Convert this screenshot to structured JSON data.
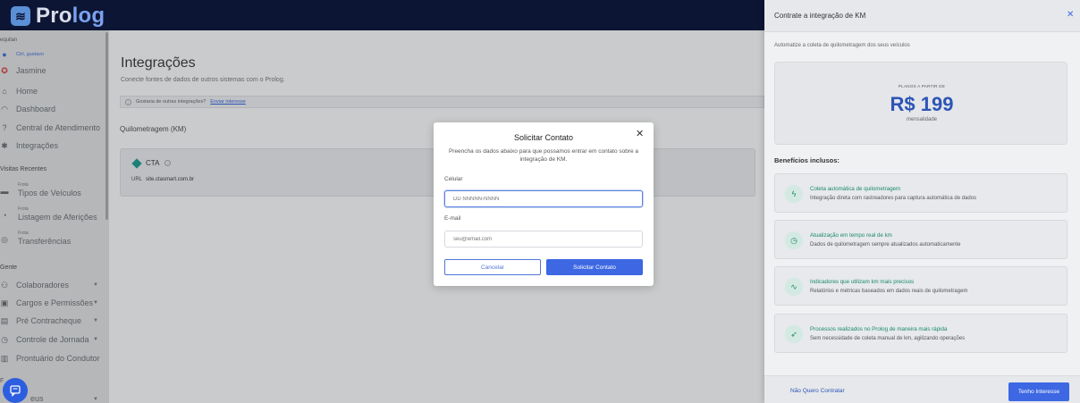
{
  "app": {
    "logo_prefix": "Pro",
    "logo_accent": "log"
  },
  "sidebar": {
    "context_label": "equilan",
    "user_label": "Ctrl, gustavo",
    "items_top": [
      {
        "label": "Jasmine",
        "icon": "company-badge-icon"
      },
      {
        "label": "Home",
        "icon": "home-icon"
      },
      {
        "label": "Dashboard",
        "icon": "gauge-icon"
      },
      {
        "label": "Central de Atendimento",
        "icon": "help-circle-icon"
      },
      {
        "label": "Integrações",
        "icon": "puzzle-icon"
      }
    ],
    "recent_section": "Visitas Recentes",
    "recent": [
      {
        "mini": "Frota",
        "label": "Tipos de Veículos"
      },
      {
        "mini": "Frota",
        "label": "Listagem de Aferições"
      },
      {
        "mini": "Frota",
        "label": "Transferências"
      }
    ],
    "people_section": "Gente",
    "people": [
      {
        "label": "Colaboradores",
        "icon": "users-icon"
      },
      {
        "label": "Cargos e Permissões",
        "icon": "id-card-icon"
      },
      {
        "label": "Pré Contracheque",
        "icon": "wallet-icon"
      },
      {
        "label": "Controle de Jornada",
        "icon": "clock-search-icon"
      },
      {
        "label": "Prontuário do Condutor",
        "icon": "folder-icon"
      }
    ],
    "bottom_mini": "F",
    "bottom_label": "eus"
  },
  "main": {
    "title": "Integrações",
    "subtitle": "Conecte fontes de dados de outros sistemas com o Prolog.",
    "info_text": "Gostaria de outras integrações?",
    "info_link": "Enviar interesse",
    "section": "Quilometragem (KM)",
    "card": {
      "name": "CTA",
      "url_label": "URL",
      "url": "site.ctasmart.com.br"
    }
  },
  "modal": {
    "title": "Solicitar Contato",
    "description": "Preencha os dados abaixo para que possamos entrar em contato sobre a integração de KM.",
    "phone_label": "Celular",
    "phone_placeholder": "DD NNNNN-NNNN",
    "email_label": "E-mail",
    "email_placeholder": "seu@email.com",
    "cancel": "Cancelar",
    "submit": "Solicitar Contato"
  },
  "drawer": {
    "title": "Contrate a integração de KM",
    "subtitle": "Automatize a coleta de quilometragem dos seus veículos",
    "price_prefix": "PLANOS A PARTIR DE",
    "price": "R$ 199",
    "price_suffix": "mensalidade",
    "benefits_title": "Benefícios inclusos:",
    "benefits": [
      {
        "title": "Coleta automática de quilometragem",
        "desc": "Integração direta com rastreadores para captura automática de dados",
        "icon": "lightning-icon"
      },
      {
        "title": "Atualização em tempo real de km",
        "desc": "Dados de quilometragem sempre atualizados automaticamente",
        "icon": "clock-icon"
      },
      {
        "title": "Indicadores que utilizam km mais precisos",
        "desc": "Relatórios e métricas baseados em dados reais de quilometragem",
        "icon": "activity-icon"
      },
      {
        "title": "Processos realizados no Prolog de maneira mais rápida",
        "desc": "Sem necessidade de coleta manual de km, agilizando operações",
        "icon": "rocket-icon"
      }
    ],
    "decline": "Não Quero Contratar",
    "interest": "Tenho Interesse"
  }
}
